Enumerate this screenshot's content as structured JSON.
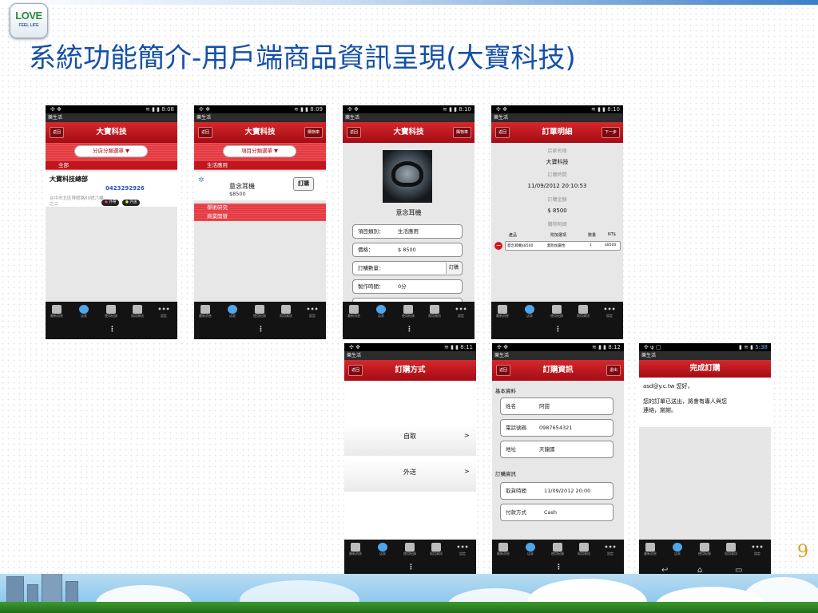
{
  "slide": {
    "logo_text": "LOVE",
    "logo_sub": "FEEL LIFE",
    "title": "系統功能簡介-用戶端商品資訊呈現(大寶科技)",
    "page_number": "9"
  },
  "common": {
    "app_name": "樂生活",
    "back": "返回",
    "cart": "購物車",
    "next": "下一步",
    "logout": "退出",
    "store": "大寶科技",
    "tabs": [
      "最新消息",
      "店家",
      "使用紀錄",
      "幫用資訊",
      "設定"
    ],
    "more_dots": "•••",
    "menu_dots": "⋮"
  },
  "screens": [
    {
      "time": "8:08",
      "dropdown": "分店分類選單 ▼",
      "section": "全部",
      "branch_name": "大寶科技總部",
      "phone": "0423292926",
      "address_line1": "台中市北區博館路89號六樓",
      "address_line2": "之二",
      "badge1": "外帶",
      "badge2": "外送"
    },
    {
      "time": "8:09",
      "dropdown": "項目分類選單 ▼",
      "category1": "生活應用",
      "product": "意念耳機",
      "price": "$8500",
      "order_btn": "訂購",
      "category2": "學術研究",
      "category3": "商業開發"
    },
    {
      "time": "8:10",
      "product": "意念耳機",
      "fields": [
        {
          "label": "項目類別：",
          "value": "生活應用"
        },
        {
          "label": "價格：",
          "value": "$ 8500"
        },
        {
          "label": "訂購數量：",
          "value": "",
          "button": "訂購"
        },
        {
          "label": "製作時間：",
          "value": "0分"
        }
      ]
    },
    {
      "time": "8:10",
      "title": "訂單明細",
      "store_label": "店家名稱",
      "store_value": "大寶科技",
      "time_label": "訂購時間",
      "time_value": "11/09/2012 20:10:53",
      "amount_label": "訂購金額",
      "amount_value": "$ 8500",
      "detail_label": "購物明細",
      "columns": [
        "產品",
        "附加選項",
        "數量",
        "NT$"
      ],
      "row": [
        "意念耳機$8500",
        "無附加屬性",
        "1",
        "$8500"
      ]
    },
    {
      "time": "8:11",
      "title": "訂購方式",
      "options": [
        "自取",
        "外送"
      ],
      "arrow": ">"
    },
    {
      "time": "8:12",
      "title": "訂購資訊",
      "basic_label": "基本資料",
      "basic": [
        {
          "label": "姓名",
          "value": "阿甜"
        },
        {
          "label": "電話號碼",
          "value": "0987654321"
        },
        {
          "label": "地址",
          "value": "天龍國"
        }
      ],
      "order_label": "訂購資訊",
      "order": [
        {
          "label": "取貨時間",
          "value": "11/09/2012 20:00"
        },
        {
          "label": "付款方式",
          "value": "Cash"
        }
      ]
    },
    {
      "time": "5:38",
      "title": "完成訂購",
      "greeting": "asd@y.c.tw 您好，",
      "message_line1": "您的訂單已送出，將會有專人與您",
      "message_line2": "連絡，謝謝。"
    }
  ]
}
